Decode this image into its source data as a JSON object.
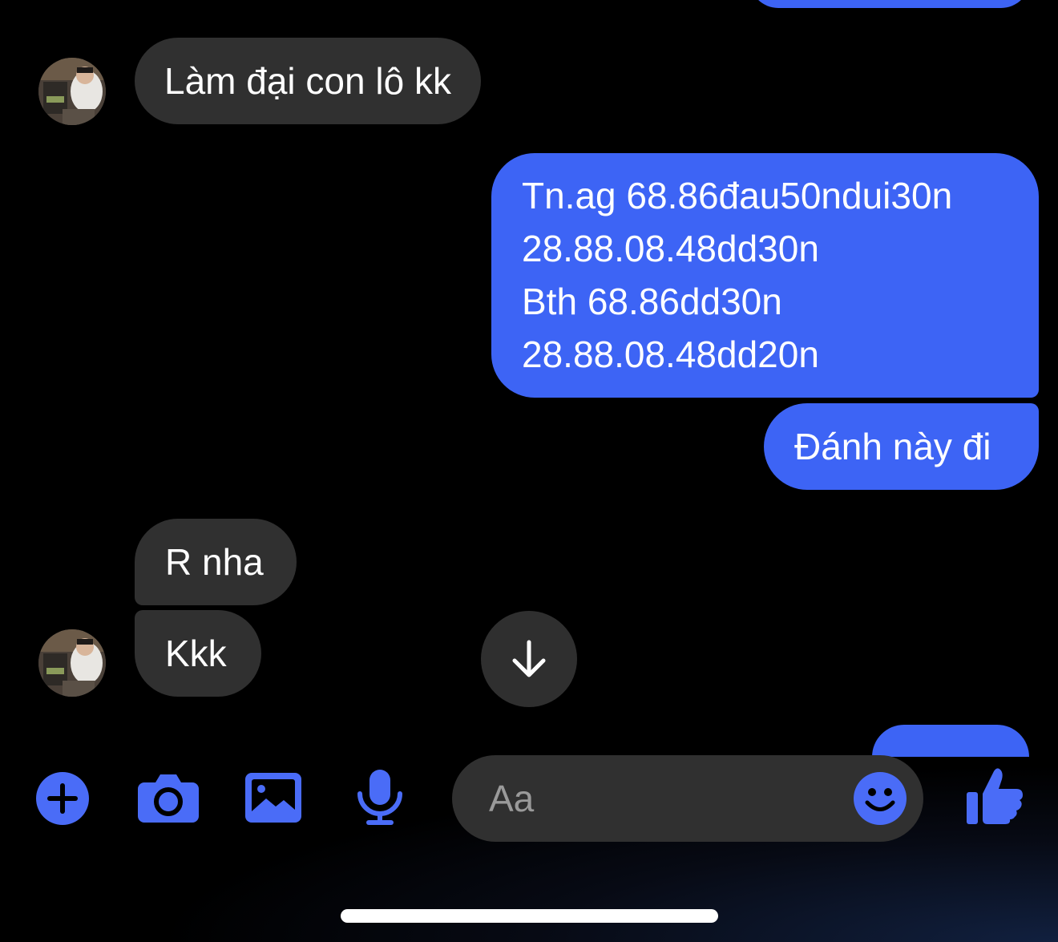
{
  "conversation": {
    "messages": [
      {
        "id": "m1",
        "sender": "contact",
        "text": "Làm đại con lô kk"
      },
      {
        "id": "m2",
        "sender": "me",
        "text": "Tn.ag 68.86đau50ndui30n\n28.88.08.48dd30n\nBth 68.86dd30n\n28.88.08.48dd20n"
      },
      {
        "id": "m3",
        "sender": "me",
        "text": "Đánh này đi"
      },
      {
        "id": "m4",
        "sender": "contact",
        "text": "R nha"
      },
      {
        "id": "m5",
        "sender": "contact",
        "text": "Kkk"
      }
    ]
  },
  "composer": {
    "placeholder": "Aa",
    "icons": [
      "plus-circle-icon",
      "camera-icon",
      "photo-icon",
      "microphone-icon",
      "smiley-icon",
      "thumbs-up-icon"
    ]
  },
  "icons": {
    "scroll_down": "arrow-down-icon",
    "avatar": "contact-avatar"
  },
  "colors": {
    "background": "#000000",
    "outgoing_bubble": "#3d64f5",
    "incoming_bubble": "#303030",
    "accent": "#4a6cf7",
    "text": "#ffffff",
    "placeholder": "#9a9a9a"
  }
}
